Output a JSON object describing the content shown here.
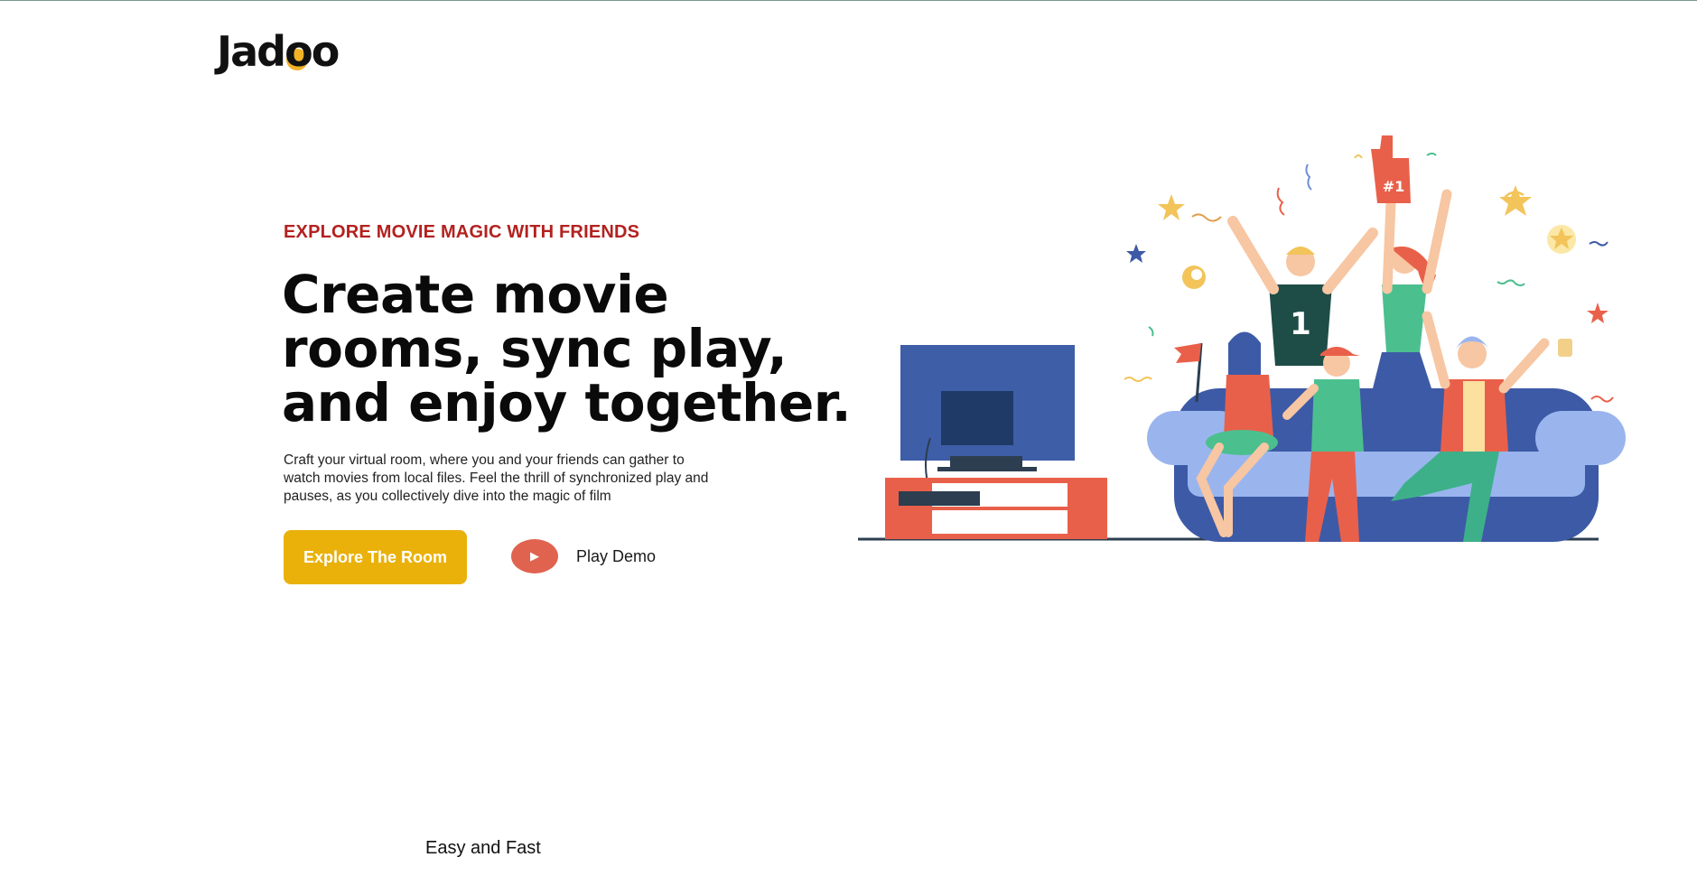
{
  "brand": {
    "logo_text_a": "Jad",
    "logo_text_b": "oo",
    "accent_color": "#f0a500"
  },
  "hero": {
    "eyebrow": "EXPLORE MOVIE MAGIC WITH FRIENDS",
    "headline": "Create movie rooms, sync play, and enjoy together.",
    "description": "Craft your virtual room, where you and your friends can gather to watch movies from local files. Feel the thrill of synchronized play and pauses, as you collectively dive into the magic of film",
    "cta_label": "Explore The Room",
    "demo_label": "Play Demo",
    "play_icon": "▶",
    "colors": {
      "eyebrow": "#b3211f",
      "cta": "#e9b10a",
      "play": "#e0634f"
    }
  },
  "illustration": {
    "icon": "friends-watching-tv-illustration",
    "jersey_number": "1",
    "foam_finger_text": "#1"
  },
  "next_section": {
    "label": "Easy and Fast"
  }
}
